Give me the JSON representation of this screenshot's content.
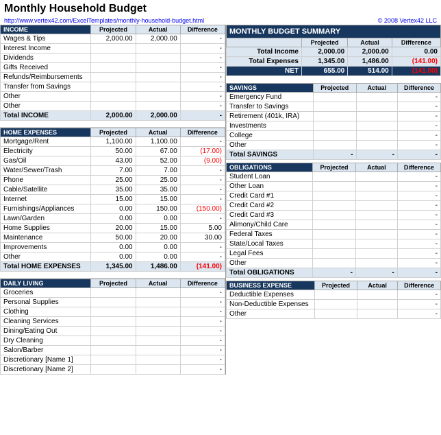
{
  "title": "Monthly Household Budget",
  "url": "http://www.vertex42.com/ExcelTemplates/monthly-household-budget.html",
  "copyright": "© 2008 Vertex42 LLC",
  "columns": {
    "projected": "Projected",
    "actual": "Actual",
    "difference": "Difference"
  },
  "income": {
    "header": "INCOME",
    "rows": [
      {
        "label": "Wages & Tips",
        "projected": "2,000.00",
        "actual": "2,000.00",
        "diff": "-"
      },
      {
        "label": "Interest Income",
        "projected": "",
        "actual": "",
        "diff": "-"
      },
      {
        "label": "Dividends",
        "projected": "",
        "actual": "",
        "diff": "-"
      },
      {
        "label": "Gifts Received",
        "projected": "",
        "actual": "",
        "diff": "-"
      },
      {
        "label": "Refunds/Reimbursements",
        "projected": "",
        "actual": "",
        "diff": "-"
      },
      {
        "label": "Transfer from Savings",
        "projected": "",
        "actual": "",
        "diff": "-"
      },
      {
        "label": "Other",
        "projected": "",
        "actual": "",
        "diff": "-"
      },
      {
        "label": "Other",
        "projected": "",
        "actual": "",
        "diff": "-"
      }
    ],
    "total_label": "Total INCOME",
    "total_projected": "2,000.00",
    "total_actual": "2,000.00",
    "total_diff": "-"
  },
  "home_expenses": {
    "header": "HOME EXPENSES",
    "rows": [
      {
        "label": "Mortgage/Rent",
        "projected": "1,100.00",
        "actual": "1,100.00",
        "diff": "-"
      },
      {
        "label": "Electricity",
        "projected": "50.00",
        "actual": "67.00",
        "diff": "(17.00)"
      },
      {
        "label": "Gas/Oil",
        "projected": "43.00",
        "actual": "52.00",
        "diff": "(9.00)"
      },
      {
        "label": "Water/Sewer/Trash",
        "projected": "7.00",
        "actual": "7.00",
        "diff": "-"
      },
      {
        "label": "Phone",
        "projected": "25.00",
        "actual": "25.00",
        "diff": "-"
      },
      {
        "label": "Cable/Satellite",
        "projected": "35.00",
        "actual": "35.00",
        "diff": "-"
      },
      {
        "label": "Internet",
        "projected": "15.00",
        "actual": "15.00",
        "diff": "-"
      },
      {
        "label": "Furnishings/Appliances",
        "projected": "0.00",
        "actual": "150.00",
        "diff": "(150.00)"
      },
      {
        "label": "Lawn/Garden",
        "projected": "0.00",
        "actual": "0.00",
        "diff": "-"
      },
      {
        "label": "Home Supplies",
        "projected": "20.00",
        "actual": "15.00",
        "diff": "5.00"
      },
      {
        "label": "Maintenance",
        "projected": "50.00",
        "actual": "20.00",
        "diff": "30.00"
      },
      {
        "label": "Improvements",
        "projected": "0.00",
        "actual": "0.00",
        "diff": "-"
      },
      {
        "label": "Other",
        "projected": "0.00",
        "actual": "0.00",
        "diff": "-"
      }
    ],
    "total_label": "Total HOME EXPENSES",
    "total_projected": "1,345.00",
    "total_actual": "1,486.00",
    "total_diff": "(141.00)"
  },
  "daily_living": {
    "header": "DAILY LIVING",
    "rows": [
      {
        "label": "Groceries",
        "projected": "",
        "actual": "",
        "diff": "-"
      },
      {
        "label": "Personal Supplies",
        "projected": "",
        "actual": "",
        "diff": "-"
      },
      {
        "label": "Clothing",
        "projected": "",
        "actual": "",
        "diff": "-"
      },
      {
        "label": "Cleaning Services",
        "projected": "",
        "actual": "",
        "diff": "-"
      },
      {
        "label": "Dining/Eating Out",
        "projected": "",
        "actual": "",
        "diff": "-"
      },
      {
        "label": "Dry Cleaning",
        "projected": "",
        "actual": "",
        "diff": "-"
      },
      {
        "label": "Salon/Barber",
        "projected": "",
        "actual": "",
        "diff": "-"
      },
      {
        "label": "Discretionary [Name 1]",
        "projected": "",
        "actual": "",
        "diff": "-"
      },
      {
        "label": "Discretionary [Name 2]",
        "projected": "",
        "actual": "",
        "diff": "-"
      }
    ]
  },
  "monthly_budget_summary": {
    "header": "MONTHLY BUDGET SUMMARY",
    "total_income": {
      "label": "Total Income",
      "projected": "2,000.00",
      "actual": "2,000.00",
      "diff": "0.00"
    },
    "total_expenses": {
      "label": "Total Expenses",
      "projected": "1,345.00",
      "actual": "1,486.00",
      "diff": "(141.00)"
    },
    "net": {
      "label": "NET",
      "projected": "655.00",
      "actual": "514.00",
      "diff": "(141.00)"
    }
  },
  "savings": {
    "header": "SAVINGS",
    "rows": [
      {
        "label": "Emergency Fund",
        "projected": "",
        "actual": "",
        "diff": "-"
      },
      {
        "label": "Transfer to Savings",
        "projected": "",
        "actual": "",
        "diff": "-"
      },
      {
        "label": "Retirement (401k, IRA)",
        "projected": "",
        "actual": "",
        "diff": "-"
      },
      {
        "label": "Investments",
        "projected": "",
        "actual": "",
        "diff": "-"
      },
      {
        "label": "College",
        "projected": "",
        "actual": "",
        "diff": "-"
      },
      {
        "label": "Other",
        "projected": "",
        "actual": "",
        "diff": "-"
      }
    ],
    "total_label": "Total SAVINGS",
    "total_projected": "-",
    "total_actual": "-",
    "total_diff": "-"
  },
  "obligations": {
    "header": "OBLIGATIONS",
    "rows": [
      {
        "label": "Student Loan",
        "projected": "",
        "actual": "",
        "diff": "-"
      },
      {
        "label": "Other Loan",
        "projected": "",
        "actual": "",
        "diff": "-"
      },
      {
        "label": "Credit Card #1",
        "projected": "",
        "actual": "",
        "diff": "-"
      },
      {
        "label": "Credit Card #2",
        "projected": "",
        "actual": "",
        "diff": "-"
      },
      {
        "label": "Credit Card #3",
        "projected": "",
        "actual": "",
        "diff": "-"
      },
      {
        "label": "Alimony/Child Care",
        "projected": "",
        "actual": "",
        "diff": "-"
      },
      {
        "label": "Federal Taxes",
        "projected": "",
        "actual": "",
        "diff": "-"
      },
      {
        "label": "State/Local Taxes",
        "projected": "",
        "actual": "",
        "diff": "-"
      },
      {
        "label": "Legal Fees",
        "projected": "",
        "actual": "",
        "diff": "-"
      },
      {
        "label": "Other",
        "projected": "",
        "actual": "",
        "diff": "-"
      }
    ],
    "total_label": "Total OBLIGATIONS",
    "total_projected": "-",
    "total_actual": "-",
    "total_diff": "-"
  },
  "business_expense": {
    "header": "BUSINESS EXPENSE",
    "rows": [
      {
        "label": "Deductible Expenses",
        "projected": "",
        "actual": "",
        "diff": "-"
      },
      {
        "label": "Non-Deductible Expenses",
        "projected": "",
        "actual": "",
        "diff": "-"
      },
      {
        "label": "Other",
        "projected": "",
        "actual": "",
        "diff": "-"
      }
    ]
  }
}
